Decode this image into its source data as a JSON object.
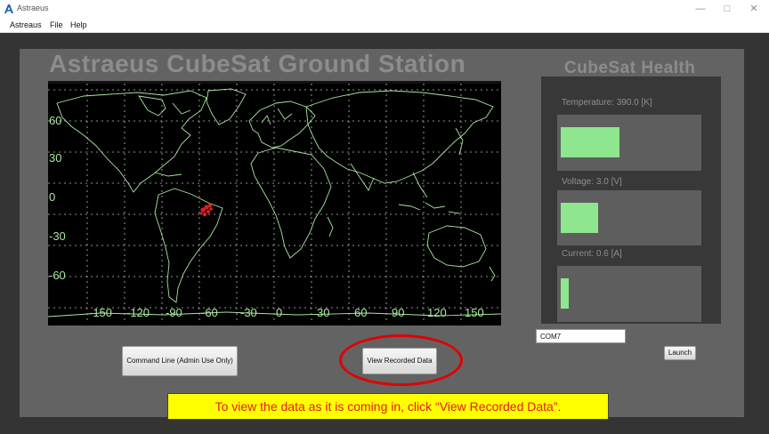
{
  "window": {
    "title": "Astraeus",
    "controls": [
      "—",
      "□",
      "✕"
    ]
  },
  "menu": {
    "items": [
      "Astreaus",
      "File",
      "Help"
    ]
  },
  "main": {
    "title": "Astraeus CubeSat Ground Station",
    "map": {
      "lat_labels": [
        "60",
        "30",
        "0",
        "-30",
        "-60"
      ],
      "lon_labels": [
        "-150",
        "-120",
        "-90",
        "-60",
        "-30",
        "0",
        "30",
        "60",
        "90",
        "120",
        "150"
      ],
      "marker_color": "#e02020",
      "coastline_color": "#a8e6a0"
    },
    "command_line_button": "Command Line (Admin Use Only)",
    "view_recorded_button": "View Recorded Data"
  },
  "health": {
    "title": "CubeSat Health",
    "bar_color": "#8ee68e",
    "temperature": {
      "label": "Temperature: 390.0  [K]",
      "fill": 0.43
    },
    "voltage": {
      "label": "Voltage: 3.0  [V]",
      "fill": 0.27
    },
    "current": {
      "label": "Current: 0.6  [A]",
      "fill": 0.06
    }
  },
  "serial": {
    "port_value": "COM7",
    "launch_button": "Launch"
  },
  "annotation": {
    "text": "To view the data as it is coming in, click “View Recorded Data”."
  }
}
